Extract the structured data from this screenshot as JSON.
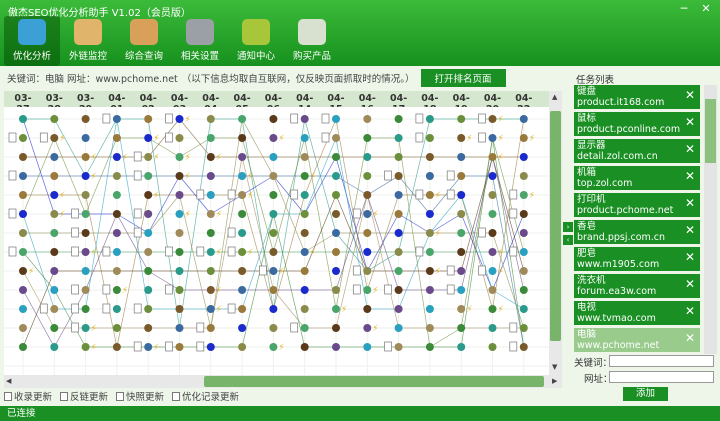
{
  "app": {
    "title": "傲杰SEO优化分析助手 V1.02（会员版）"
  },
  "window": {
    "minimize": "─",
    "close": "✕"
  },
  "toolbar": [
    {
      "label": "优化分析",
      "icon": "magnifier-icon",
      "color": "#3aa0d6",
      "active": true
    },
    {
      "label": "外链监控",
      "icon": "headset-user-icon",
      "color": "#e0b46a",
      "active": false
    },
    {
      "label": "综合查询",
      "icon": "users-icon",
      "color": "#d9a05a",
      "active": false
    },
    {
      "label": "相关设置",
      "icon": "tools-icon",
      "color": "#9aa0a6",
      "active": false
    },
    {
      "label": "通知中心",
      "icon": "bar-chart-icon",
      "color": "#a7c63a",
      "active": false
    },
    {
      "label": "购买产品",
      "icon": "shopping-cart-icon",
      "color": "#d8e0d0",
      "active": false
    }
  ],
  "keyword_bar": {
    "label": "关键词：电脑  网址：www.pchome.net",
    "note": "（以下信息均取自互联网，仅反映页面抓取时的情况。）",
    "open_button": "打开排名页面"
  },
  "dates": [
    "03-27",
    "03-28",
    "03-29",
    "04-01",
    "04-02",
    "04-03",
    "04-04",
    "04-05",
    "04-06",
    "04-14",
    "04-15",
    "04-16",
    "04-17",
    "04-18",
    "04-19",
    "04-20",
    "04-22"
  ],
  "legend": [
    {
      "label": "收录更新",
      "icon": "page-icon"
    },
    {
      "label": "反链更新",
      "icon": "lightning-icon"
    },
    {
      "label": "快照更新",
      "icon": "snapshot-icon"
    },
    {
      "label": "优化记录更新",
      "icon": "record-icon"
    }
  ],
  "tasks_label": "任务列表",
  "tasks": [
    {
      "keyword": "键盘",
      "url": "product.it168.com"
    },
    {
      "keyword": "鼠标",
      "url": "product.pconline.com"
    },
    {
      "keyword": "显示器",
      "url": "detail.zol.com.cn"
    },
    {
      "keyword": "机箱",
      "url": "top.zol.com"
    },
    {
      "keyword": "打印机",
      "url": "product.pchome.net"
    },
    {
      "keyword": "香皂",
      "url": "brand.ppsj.com.cn"
    },
    {
      "keyword": "肥皂",
      "url": "www.m1905.com"
    },
    {
      "keyword": "洗衣机",
      "url": "forum.ea3w.com"
    },
    {
      "keyword": "电视",
      "url": "www.tvmao.com"
    },
    {
      "keyword": "电脑",
      "url": "www.pchome.net",
      "selected": true
    }
  ],
  "task_remove": "✕",
  "form": {
    "keyword_label": "关键词：",
    "url_label": "网址：",
    "add_button": "添加"
  },
  "status": "已连接",
  "colors": {
    "accent": "#1a8f23",
    "accent_light": "#3cbb3a"
  }
}
